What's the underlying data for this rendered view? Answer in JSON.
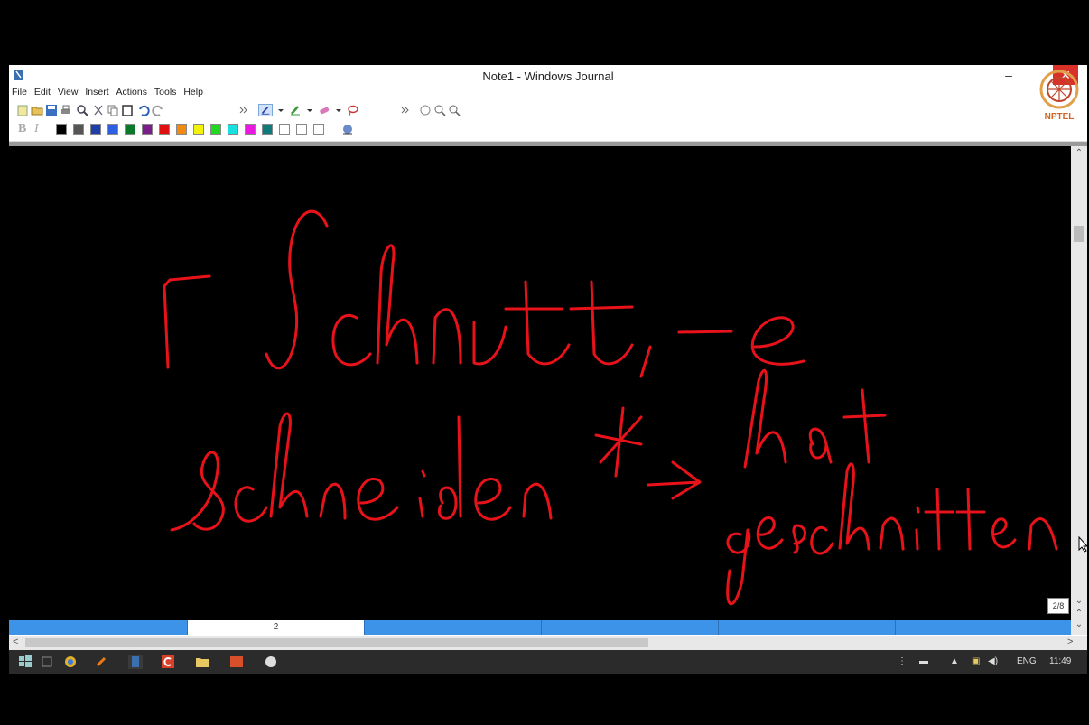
{
  "window": {
    "title": "Note1 - Windows Journal",
    "minimize": "–",
    "close": "✕"
  },
  "menu": [
    "File",
    "Edit",
    "View",
    "Insert",
    "Actions",
    "Tools",
    "Help"
  ],
  "toolbar2": {
    "bold": "B",
    "italic": "I"
  },
  "logo": {
    "text": "NPTEL"
  },
  "colors": {
    "ink": "#e8121a",
    "swatches": [
      "#000000",
      "#555555",
      "#1f3fa8",
      "#2e5fe0",
      "#0a7a2a",
      "#7a1f8a",
      "#e01010",
      "#f08a10",
      "#f2f20a",
      "#20d820",
      "#18e0e0",
      "#e818e0",
      "#0e7a7a",
      "#ffffff",
      "#ffffff",
      "#ffffff"
    ]
  },
  "tabs": {
    "active_page": "2"
  },
  "page_indicator": "2/8",
  "taskbar": {
    "language": "ENG",
    "time": "11:49"
  }
}
